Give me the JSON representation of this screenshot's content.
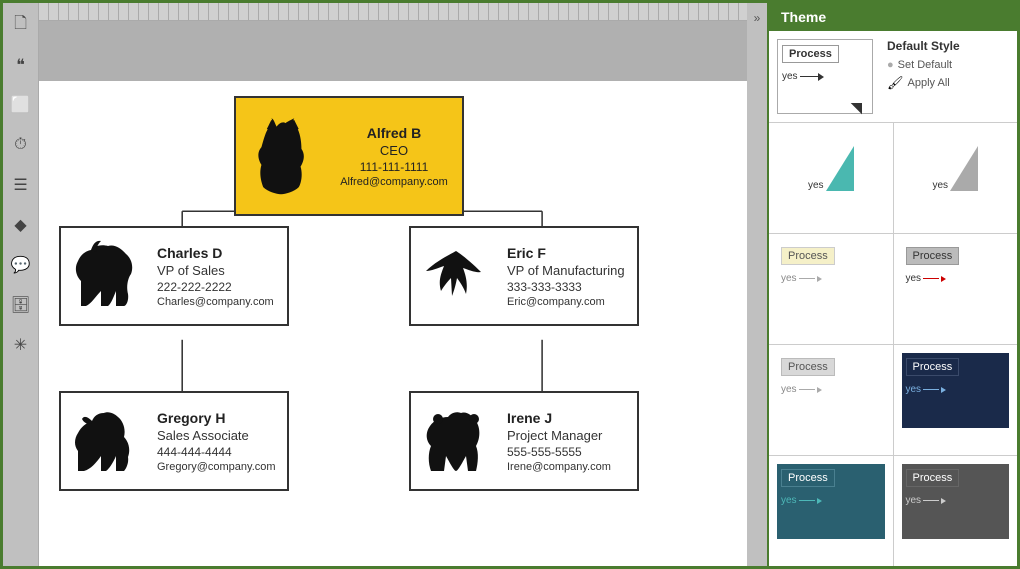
{
  "panel": {
    "title": "Theme",
    "collapse_icon": "»",
    "default_style": {
      "label": "Default Style",
      "set_default_label": "Set Default",
      "apply_all_label": "Apply All"
    }
  },
  "sidebar_icons": [
    {
      "name": "page-icon",
      "symbol": "🗋"
    },
    {
      "name": "quote-icon",
      "symbol": "❝"
    },
    {
      "name": "present-icon",
      "symbol": "⬛"
    },
    {
      "name": "clock-icon",
      "symbol": "🕐"
    },
    {
      "name": "layers-icon",
      "symbol": "≡"
    },
    {
      "name": "diamond-icon",
      "symbol": "◆"
    },
    {
      "name": "chat-icon",
      "symbol": "💬"
    },
    {
      "name": "db-icon",
      "symbol": "🗃"
    },
    {
      "name": "asterisk-icon",
      "symbol": "✳"
    }
  ],
  "org_chart": {
    "ceo": {
      "name": "Alfred B",
      "title": "CEO",
      "phone": "111-111-1111",
      "email": "Alfred@company.com"
    },
    "vp_sales": {
      "name": "Charles D",
      "title": "VP of Sales",
      "phone": "222-222-2222",
      "email": "Charles@company.com"
    },
    "vp_manufacturing": {
      "name": "Eric F",
      "title": "VP of Manufacturing",
      "phone": "333-333-3333",
      "email": "Eric@company.com"
    },
    "sales_associate": {
      "name": "Gregory H",
      "title": "Sales Associate",
      "phone": "444-444-4444",
      "email": "Gregory@company.com"
    },
    "project_manager": {
      "name": "Irene J",
      "title": "Project Manager",
      "phone": "555-555-5555",
      "email": "Irene@company.com"
    }
  },
  "themes": [
    {
      "id": "default",
      "label": "default-white",
      "process_color": "#fff",
      "process_border": "#999",
      "yes_color": "#333",
      "arrow_color": "#333",
      "selected": true
    },
    {
      "id": "teal",
      "label": "teal-arrow",
      "process_color": "none",
      "shape_color": "#4db8b8",
      "yes_color": "#333"
    },
    {
      "id": "silver",
      "label": "silver-arrow",
      "process_color": "none",
      "shape_color": "#b0b0b0",
      "yes_color": "#333"
    },
    {
      "id": "light-yellow",
      "label": "light-yellow",
      "process_color": "#f5f0c8",
      "process_border": "#ccc",
      "yes_color": "#888"
    },
    {
      "id": "gray-box",
      "label": "gray-box",
      "process_color": "#b8b8b8",
      "process_border": "#999",
      "yes_color": "#333",
      "arrow_color": "#c00"
    },
    {
      "id": "light-gray",
      "label": "light-gray",
      "process_color": "#d8d8d8",
      "process_border": "#bbb",
      "yes_color": "#888"
    },
    {
      "id": "dark-blue",
      "label": "dark-blue",
      "process_color": "#1a2a4a",
      "process_border": "#1a2a4a",
      "yes_color": "#7ab0e0"
    },
    {
      "id": "teal-dark",
      "label": "teal-dark",
      "process_color": "#2a6070",
      "process_border": "#2a6070",
      "yes_color": "#4db8b8"
    },
    {
      "id": "dark-gray",
      "label": "dark-gray",
      "process_color": "#555",
      "process_border": "#333",
      "yes_color": "#aaa"
    }
  ],
  "process_label": "Process",
  "yes_label": "yes"
}
